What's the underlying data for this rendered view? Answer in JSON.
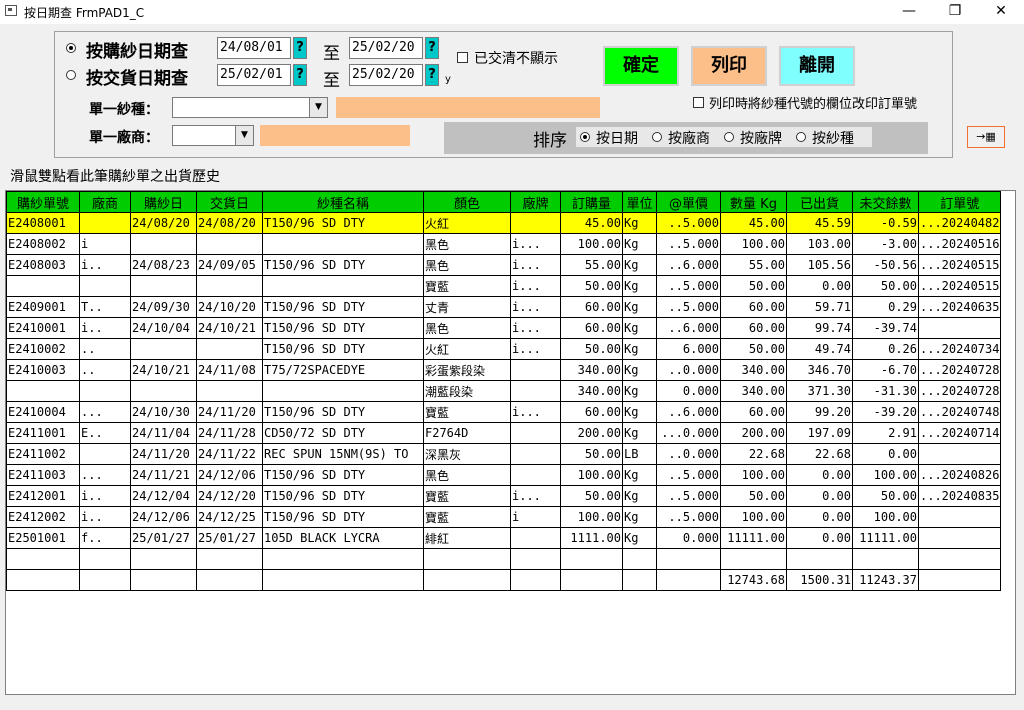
{
  "window": {
    "title": "按日期查  FrmPAD1_C",
    "min": "—",
    "restore": "❐",
    "close": "✕"
  },
  "filters": {
    "radio_purchase": "按購紗日期查",
    "radio_delivery": "按交貨日期查",
    "purchase_from": "24/08/01",
    "purchase_to": "25/02/20",
    "delivery_from": "25/02/01",
    "delivery_to": "25/02/20",
    "to_label": "至",
    "q": "?",
    "y_mark": "y",
    "hide_settled": "已交清不顯示",
    "print_option": "列印時將紗種代號的欄位改印訂單號",
    "yarn_label": "單一紗種：",
    "vendor_label": "單一廠商：",
    "yarn_value": "",
    "vendor_value": ""
  },
  "buttons": {
    "confirm": "確定",
    "print": "列印",
    "exit": "離開"
  },
  "sort": {
    "label": "排序",
    "options": [
      "按日期",
      "按廠商",
      "按廠牌",
      "按紗種"
    ],
    "selected": 0
  },
  "hint": "滑鼠雙點看此筆購紗單之出貨歷史",
  "table": {
    "columns": [
      "購紗單號",
      "廠商",
      "購紗日",
      "交貨日",
      "紗種名稱",
      "顏色",
      "廠牌",
      "訂購量",
      "單位",
      "@單價",
      "數量 Kg",
      "已出貨",
      "未交餘數",
      "訂單號"
    ],
    "rows": [
      [
        "E2408001",
        "",
        "24/08/20",
        "24/08/20",
        "T150/96 SD DTY",
        "火紅",
        "",
        "45.00",
        "Kg",
        "..5.000",
        "45.00",
        "45.59",
        "-0.59",
        "...20240482"
      ],
      [
        "E2408002",
        "i",
        "",
        "",
        "",
        "黑色",
        "i...",
        "100.00",
        "Kg",
        "..5.000",
        "100.00",
        "103.00",
        "-3.00",
        "...20240516"
      ],
      [
        "E2408003",
        "i..",
        "24/08/23",
        "24/09/05",
        "T150/96 SD DTY",
        "黑色",
        "i...",
        "55.00",
        "Kg",
        "..6.000",
        "55.00",
        "105.56",
        "-50.56",
        "...20240515"
      ],
      [
        "",
        "",
        "",
        "",
        "",
        "寶藍",
        "i...",
        "50.00",
        "Kg",
        "..5.000",
        "50.00",
        "0.00",
        "50.00",
        "...20240515"
      ],
      [
        "E2409001",
        "T..",
        "24/09/30",
        "24/10/20",
        "T150/96 SD DTY",
        "丈青",
        "i...",
        "60.00",
        "Kg",
        "..5.000",
        "60.00",
        "59.71",
        "0.29",
        "...20240635"
      ],
      [
        "E2410001",
        "i..",
        "24/10/04",
        "24/10/21",
        "T150/96 SD DTY",
        "黑色",
        "i...",
        "60.00",
        "Kg",
        "..6.000",
        "60.00",
        "99.74",
        "-39.74",
        ""
      ],
      [
        "E2410002",
        "..",
        "",
        "",
        "T150/96 SD DTY",
        "火紅",
        "i...",
        "50.00",
        "Kg",
        "6.000",
        "50.00",
        "49.74",
        "0.26",
        "...20240734"
      ],
      [
        "E2410003",
        "..",
        "24/10/21",
        "24/11/08",
        "T75/72SPACEDYE",
        "彩蛋紫段染",
        "",
        "340.00",
        "Kg",
        "..0.000",
        "340.00",
        "346.70",
        "-6.70",
        "...20240728"
      ],
      [
        "",
        "",
        "",
        "",
        "",
        "潮藍段染",
        "",
        "340.00",
        "Kg",
        "0.000",
        "340.00",
        "371.30",
        "-31.30",
        "...20240728"
      ],
      [
        "E2410004",
        "...",
        "24/10/30",
        "24/11/20",
        "T150/96 SD DTY",
        "寶藍",
        "i...",
        "60.00",
        "Kg",
        "..6.000",
        "60.00",
        "99.20",
        "-39.20",
        "...20240748"
      ],
      [
        "E2411001",
        "E..",
        "24/11/04",
        "24/11/28",
        "CD50/72 SD DTY",
        "F2764D",
        "",
        "200.00",
        "Kg",
        "...0.000",
        "200.00",
        "197.09",
        "2.91",
        "...20240714"
      ],
      [
        "E2411002",
        "",
        "24/11/20",
        "24/11/22",
        "REC SPUN 15NM(9S) TO",
        "深黑灰",
        "",
        "50.00",
        "LB",
        "..0.000",
        "22.68",
        "22.68",
        "0.00",
        ""
      ],
      [
        "E2411003",
        "...",
        "24/11/21",
        "24/12/06",
        "T150/96 SD DTY",
        "黑色",
        "",
        "100.00",
        "Kg",
        "..5.000",
        "100.00",
        "0.00",
        "100.00",
        "...20240826"
      ],
      [
        "E2412001",
        "i..",
        "24/12/04",
        "24/12/20",
        "T150/96 SD DTY",
        "寶藍",
        "i...",
        "50.00",
        "Kg",
        "..5.000",
        "50.00",
        "0.00",
        "50.00",
        "...20240835"
      ],
      [
        "E2412002",
        "i..",
        "24/12/06",
        "24/12/25",
        "T150/96 SD DTY",
        "寶藍",
        "i",
        "100.00",
        "Kg",
        "..5.000",
        "100.00",
        "0.00",
        "100.00",
        ""
      ],
      [
        "E2501001",
        "f..",
        "25/01/27",
        "25/01/27",
        "105D BLACK LYCRA",
        "緋紅",
        "",
        "1111.00",
        "Kg",
        "0.000",
        "11111.00",
        "0.00",
        "11111.00",
        ""
      ],
      [
        "",
        "",
        "",
        "",
        "",
        "",
        "",
        "",
        "",
        "",
        "",
        "",
        "",
        ""
      ],
      [
        "",
        "",
        "",
        "",
        "",
        "",
        "",
        "",
        "",
        "",
        "12743.68",
        "1500.31",
        "11243.37",
        ""
      ]
    ]
  },
  "export_icon": "→▦",
  "colors": {
    "header": "#00cc00",
    "selected": "#ffff00",
    "confirm": "#00ff00",
    "print": "#fcbf8a",
    "exit": "#80ffff",
    "qbtn": "#00c8c8"
  }
}
